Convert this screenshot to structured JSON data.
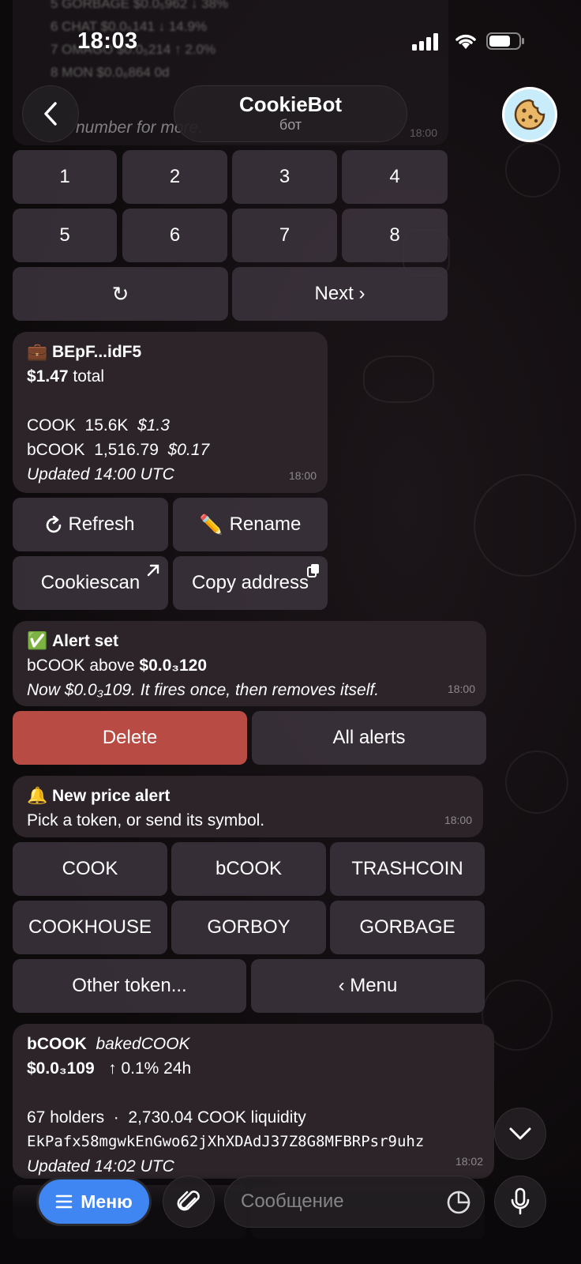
{
  "status_bar": {
    "time": "18:03"
  },
  "header": {
    "title": "CookieBot",
    "subtitle": "бот"
  },
  "top_faded": {
    "lines": [
      "5  GORBAGE  $0.0₅962  ↓ 38%",
      "6  CHAT  $0.0₅141  ↓ 14.9%",
      "7  OMAGO  $0.0₅214  ↑ 2.0%",
      "8  MON  $0.0₆864  0d"
    ],
    "prompt": "number for more.",
    "time": "18:00"
  },
  "keypad": {
    "numbers": [
      "1",
      "2",
      "3",
      "4",
      "5",
      "6",
      "7",
      "8"
    ],
    "refresh_glyph": "↻",
    "next_label": "Next ›"
  },
  "wallet": {
    "emoji": "💼",
    "name": "BEpF...idF5",
    "total_amount": "$1.47",
    "total_word": "total",
    "rows": [
      {
        "symbol": "COOK",
        "amount": "15.6K",
        "value": "$1.3"
      },
      {
        "symbol": "bCOOK",
        "amount": "1,516.79",
        "value": "$0.17"
      }
    ],
    "updated": "Updated 14:00 UTC",
    "time": "18:00",
    "refresh_label": "Refresh",
    "rename_label": "Rename",
    "rename_emoji": "✏️",
    "cookiescan_label": "Cookiescan",
    "copy_label": "Copy address"
  },
  "alert_set": {
    "emoji": "✅",
    "title": "Alert set",
    "line_prefix": "bCOOK above ",
    "line_value": "$0.0₃120",
    "note": "Now $0.0₃109. It fires once, then removes itself.",
    "time": "18:00",
    "delete_label": "Delete",
    "all_alerts_label": "All alerts"
  },
  "new_alert": {
    "emoji": "🔔",
    "title": "New price alert",
    "subtitle": "Pick a token, or send its symbol.",
    "time": "18:00",
    "tokens": [
      "COOK",
      "bCOOK",
      "TRASHCOIN",
      "COOKHOUSE",
      "GORBOY",
      "GORBAGE"
    ],
    "other_label": "Other token...",
    "menu_label": "‹ Menu"
  },
  "token_info": {
    "symbol": "bCOOK",
    "name": "bakedCOOK",
    "price": "$0.0₃109",
    "change": "↑ 0.1% 24h",
    "holders": "67 holders",
    "separator": "·",
    "liquidity": "2,730.04 COOK liquidity",
    "address": "EkPafx58mgwkEnGwo62jXhXDAdJ37Z8G8MFBRPsr9uhz",
    "updated": "Updated 14:02 UTC",
    "time": "18:02"
  },
  "composer": {
    "menu_label": "Меню",
    "placeholder": "Сообщение"
  },
  "colors": {
    "delete": "#b84b43",
    "accent": "#3f86f2",
    "bubble": "#2c2429",
    "key": "#3e3640"
  }
}
